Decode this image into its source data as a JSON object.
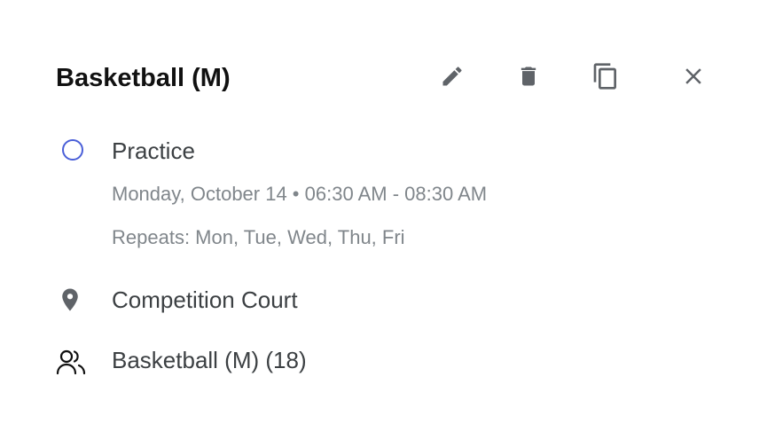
{
  "event": {
    "title": "Basketball (M)",
    "type": "Practice",
    "datetime": "Monday, October 14 • 06:30 AM - 08:30 AM",
    "repeats": "Repeats: Mon, Tue, Wed, Thu, Fri",
    "location": "Competition Court",
    "group": "Basketball (M) (18)"
  },
  "icons": {
    "edit": "pencil-icon",
    "delete": "trash-icon",
    "copy": "copy-icon",
    "close": "close-icon",
    "status": "circle-outline-icon",
    "location": "location-pin-icon",
    "group": "people-icon"
  },
  "colors": {
    "title": "#111111",
    "primary_text": "#3c4043",
    "secondary_text": "#80868b",
    "icon": "#5f6368",
    "status_circle": "#4a5fd8"
  }
}
